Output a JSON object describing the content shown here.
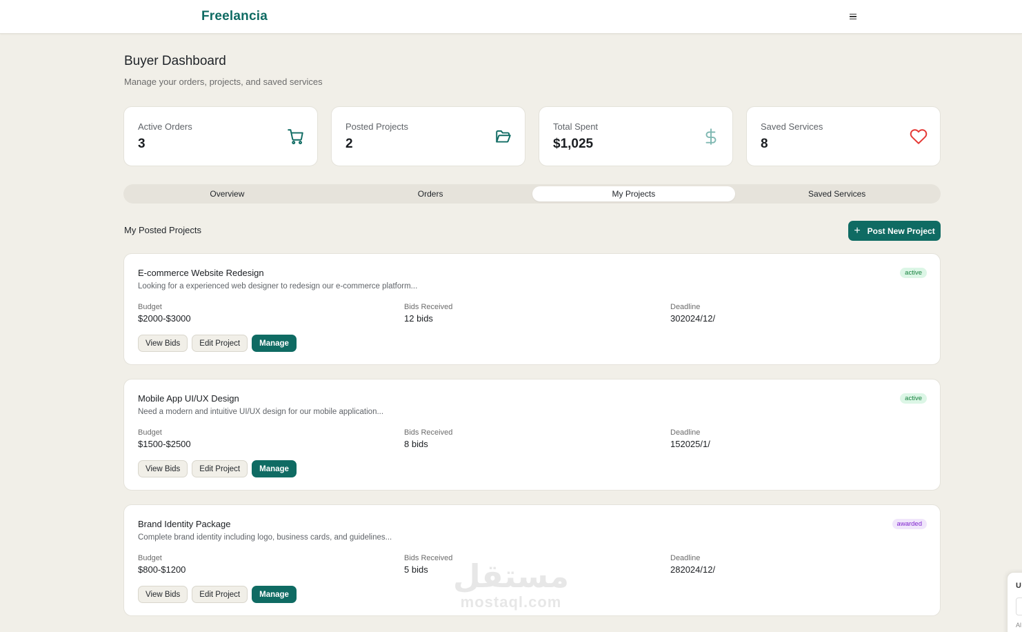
{
  "app": {
    "brand": "Freelancia"
  },
  "header": {
    "title": "Buyer Dashboard",
    "subtitle": "Manage your orders, projects, and saved services"
  },
  "stats": [
    {
      "label": "Active Orders",
      "value": "3",
      "icon": "cart-icon",
      "color": "#0f6b63"
    },
    {
      "label": "Posted Projects",
      "value": "2",
      "icon": "folder-open-icon",
      "color": "#0f6b63"
    },
    {
      "label": "Total Spent",
      "value": "$1,025",
      "icon": "dollar-icon",
      "color": "#7fb8b2"
    },
    {
      "label": "Saved Services",
      "value": "8",
      "icon": "heart-icon",
      "color": "#e53935"
    }
  ],
  "tabs": [
    {
      "label": "Overview",
      "active": false
    },
    {
      "label": "Orders",
      "active": false
    },
    {
      "label": "My Projects",
      "active": true
    },
    {
      "label": "Saved Services",
      "active": false
    }
  ],
  "section": {
    "title": "My Posted Projects",
    "post_button": "Post New Project"
  },
  "field_labels": {
    "budget": "Budget",
    "bids": "Bids Received",
    "deadline": "Deadline"
  },
  "action_labels": {
    "view_bids": "View Bids",
    "edit": "Edit Project",
    "manage": "Manage"
  },
  "projects": [
    {
      "title": "E-commerce Website Redesign",
      "description": "Looking for a experienced web designer to redesign our e-commerce platform...",
      "status": "active",
      "budget": "$2000-$3000",
      "bids": "12 bids",
      "deadline": "302024/12/"
    },
    {
      "title": "Mobile App UI/UX Design",
      "description": "Need a modern and intuitive UI/UX design for our mobile application...",
      "status": "active",
      "budget": "$1500-$2500",
      "bids": "8 bids",
      "deadline": "152025/1/"
    },
    {
      "title": "Brand Identity Package",
      "description": "Complete brand identity including logo, business cards, and guidelines...",
      "status": "awarded",
      "budget": "$800-$1200",
      "bids": "5 bids",
      "deadline": "282024/12/"
    }
  ],
  "watermark": {
    "arabic": "مستقل",
    "latin": "mostaql.com"
  },
  "side_widget": {
    "text": "U",
    "small": "Al"
  },
  "colors": {
    "brand": "#0f6b63",
    "background": "#f1efe8",
    "active_badge": "#dcf6e6",
    "awarded_badge": "#f0e6fb"
  }
}
